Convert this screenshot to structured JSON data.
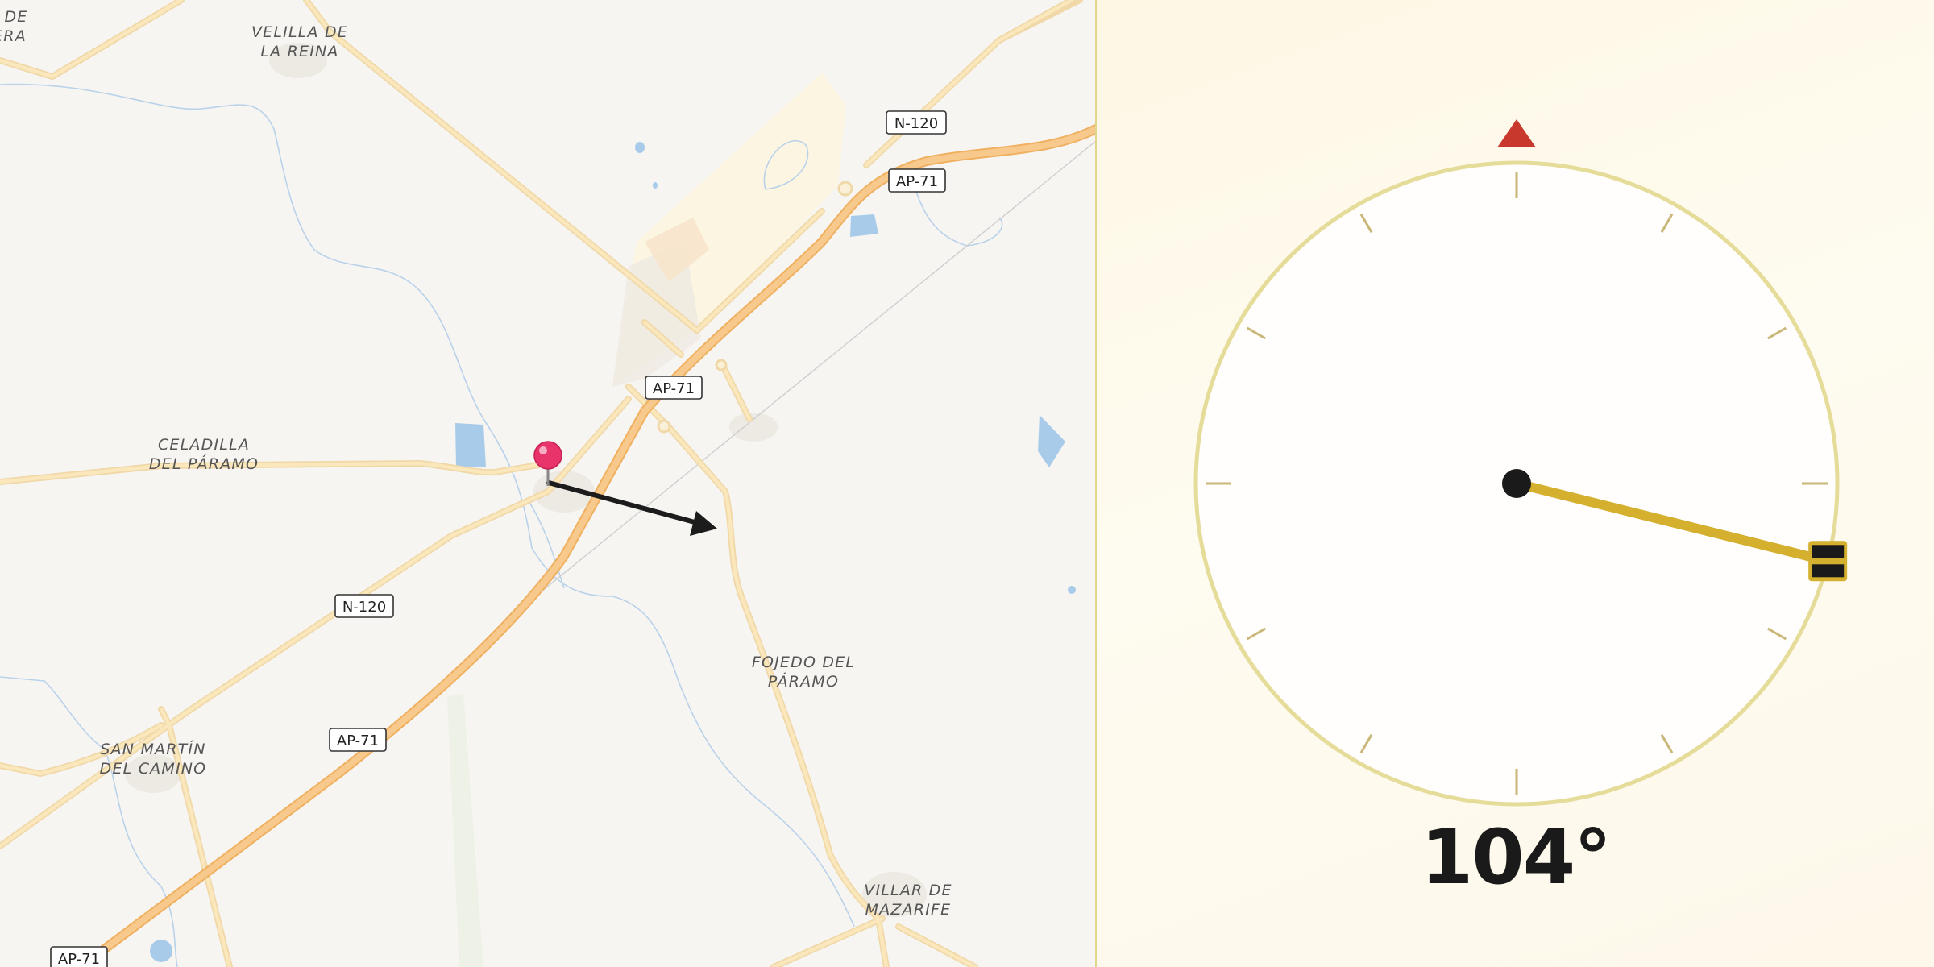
{
  "map": {
    "places": [
      {
        "id": "edge-place",
        "lines": [
          "DE",
          "ERA"
        ]
      },
      {
        "id": "velilla",
        "lines": [
          "VELILLA DE",
          "LA REINA"
        ]
      },
      {
        "id": "celadilla",
        "lines": [
          "CELADILLA",
          "DEL PÁRAMO"
        ]
      },
      {
        "id": "san-martin",
        "lines": [
          "SAN MARTÍN",
          "DEL CAMINO"
        ]
      },
      {
        "id": "fojedo",
        "lines": [
          "FOJEDO DEL",
          "PÁRAMO"
        ]
      },
      {
        "id": "villar",
        "lines": [
          "VILLAR DE",
          "MAZARIFE"
        ]
      }
    ],
    "road_shields": [
      "N-120",
      "AP-71",
      "AP-71",
      "N-120",
      "AP-71",
      "AP-71"
    ],
    "pin_color": "#e8336b",
    "arrow_color": "#1c1c1c",
    "road_color": "#f3c97a",
    "motorway_color": "#f2b46a",
    "water_color": "#a9cbea"
  },
  "compass": {
    "north_marker_color": "#c8382c",
    "needle_color": "#d4b02e",
    "ring_color": "#e6dc9a",
    "heading_value": 104,
    "heading_label": "104°"
  }
}
